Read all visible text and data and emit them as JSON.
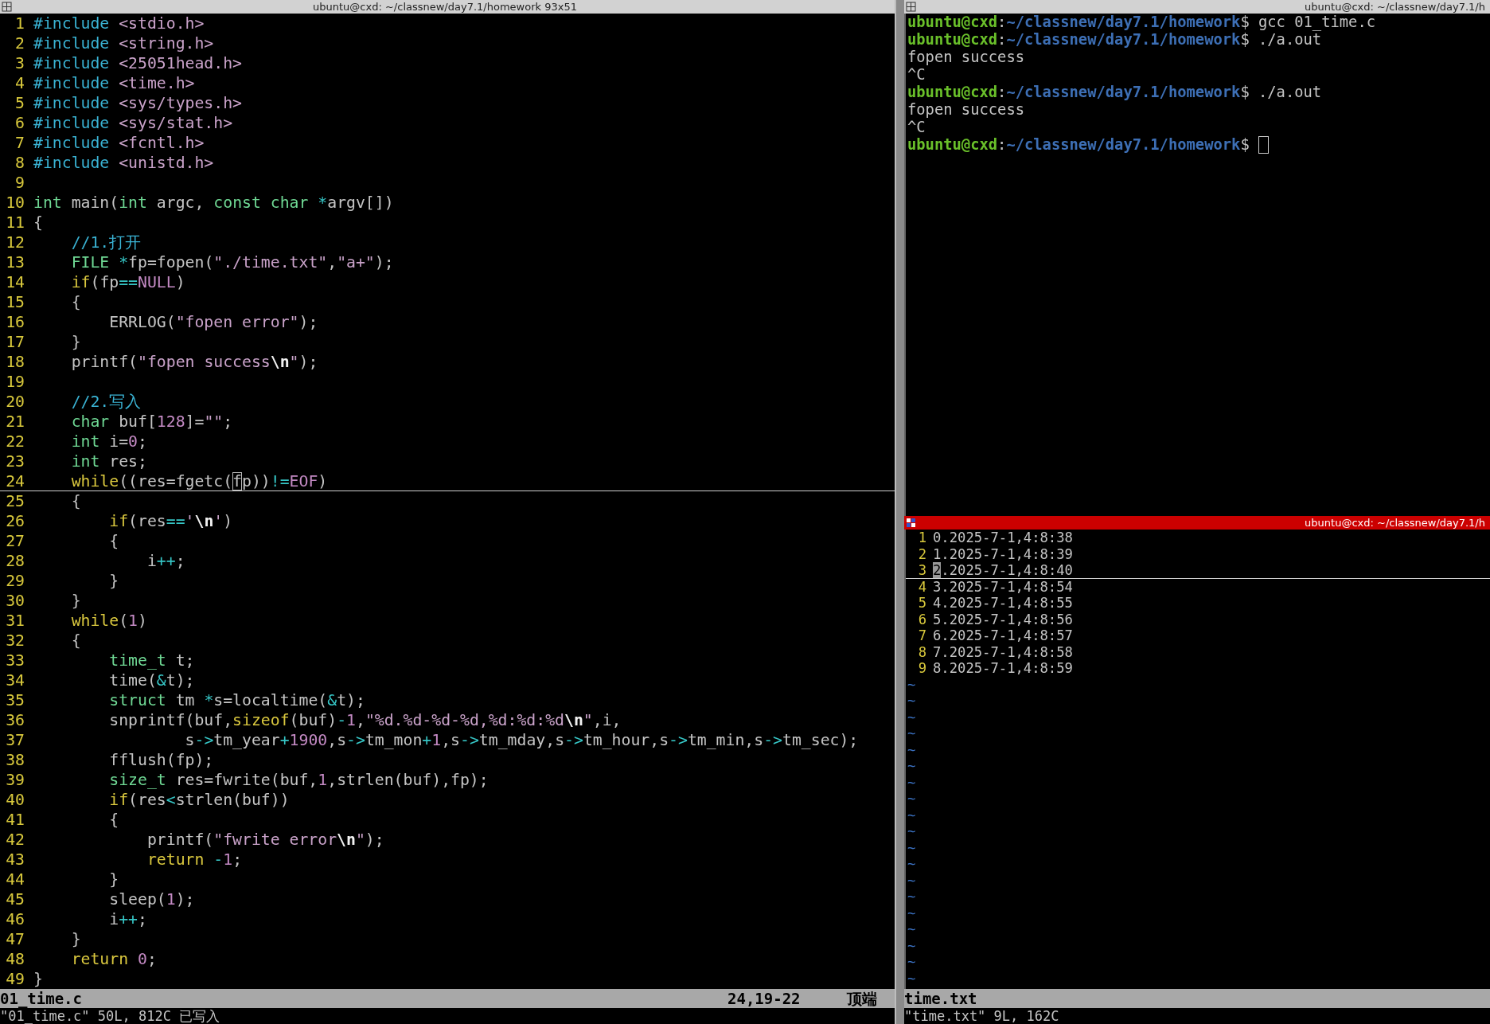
{
  "editor_pane": {
    "title": "ubuntu@cxd: ~/classnew/day7.1/homework 93x51",
    "active": false,
    "lines": [
      {
        "number": "1",
        "current": false,
        "segments": [
          {
            "kind": "pre",
            "text": "#include"
          },
          {
            "kind": "inc",
            "text": " <stdio.h>"
          }
        ]
      },
      {
        "number": "2",
        "current": false,
        "segments": [
          {
            "kind": "pre",
            "text": "#include"
          },
          {
            "kind": "inc",
            "text": " <string.h>"
          }
        ]
      },
      {
        "number": "3",
        "current": false,
        "segments": [
          {
            "kind": "pre",
            "text": "#include"
          },
          {
            "kind": "inc",
            "text": " <25051head.h>"
          }
        ]
      },
      {
        "number": "4",
        "current": false,
        "segments": [
          {
            "kind": "pre",
            "text": "#include"
          },
          {
            "kind": "inc",
            "text": " <time.h>"
          }
        ]
      },
      {
        "number": "5",
        "current": false,
        "segments": [
          {
            "kind": "pre",
            "text": "#include"
          },
          {
            "kind": "inc",
            "text": " <sys/types.h>"
          }
        ]
      },
      {
        "number": "6",
        "current": false,
        "segments": [
          {
            "kind": "pre",
            "text": "#include"
          },
          {
            "kind": "inc",
            "text": " <sys/stat.h>"
          }
        ]
      },
      {
        "number": "7",
        "current": false,
        "segments": [
          {
            "kind": "pre",
            "text": "#include"
          },
          {
            "kind": "inc",
            "text": " <fcntl.h>"
          }
        ]
      },
      {
        "number": "8",
        "current": false,
        "segments": [
          {
            "kind": "pre",
            "text": "#include"
          },
          {
            "kind": "inc",
            "text": " <unistd.h>"
          }
        ]
      },
      {
        "number": "9",
        "current": false
      },
      {
        "number": "10",
        "current": false,
        "segments": [
          {
            "kind": "type",
            "text": "int"
          },
          {
            "kind": "plain",
            "text": " main("
          },
          {
            "kind": "type",
            "text": "int"
          },
          {
            "kind": "plain",
            "text": " argc, "
          },
          {
            "kind": "type",
            "text": "const"
          },
          {
            "kind": "type",
            "text": " char"
          },
          {
            "kind": "op",
            "text": " *"
          },
          {
            "kind": "plain",
            "text": "argv[])"
          }
        ]
      },
      {
        "number": "11",
        "current": false,
        "segments": [
          {
            "kind": "plain",
            "text": "{"
          }
        ]
      },
      {
        "number": "12",
        "current": false,
        "segments": [
          {
            "kind": "comment",
            "text": "    //1.打开"
          }
        ]
      },
      {
        "number": "13",
        "current": false,
        "segments": [
          {
            "kind": "type",
            "text": "    FILE"
          },
          {
            "kind": "op",
            "text": " *"
          },
          {
            "kind": "plain",
            "text": "fp=fopen("
          },
          {
            "kind": "str",
            "text": "\"./time.txt\""
          },
          {
            "kind": "plain",
            "text": ","
          },
          {
            "kind": "str",
            "text": "\"a+\""
          },
          {
            "kind": "plain",
            "text": ");"
          }
        ]
      },
      {
        "number": "14",
        "current": false,
        "segments": [
          {
            "kind": "kw",
            "text": "    if"
          },
          {
            "kind": "plain",
            "text": "(fp"
          },
          {
            "kind": "op",
            "text": "=="
          },
          {
            "kind": "const",
            "text": "NULL"
          },
          {
            "kind": "plain",
            "text": ")"
          }
        ]
      },
      {
        "number": "15",
        "current": false,
        "segments": [
          {
            "kind": "plain",
            "text": "    {"
          }
        ]
      },
      {
        "number": "16",
        "current": false,
        "segments": [
          {
            "kind": "plain",
            "text": "        ERRLOG("
          },
          {
            "kind": "str",
            "text": "\"fopen error\""
          },
          {
            "kind": "plain",
            "text": ");"
          }
        ]
      },
      {
        "number": "17",
        "current": false,
        "segments": [
          {
            "kind": "plain",
            "text": "    }"
          }
        ]
      },
      {
        "number": "18",
        "current": false,
        "segments": [
          {
            "kind": "plain",
            "text": "    printf("
          },
          {
            "kind": "str",
            "text": "\"fopen success"
          },
          {
            "kind": "esc",
            "text": "\\n"
          },
          {
            "kind": "str",
            "text": "\""
          },
          {
            "kind": "plain",
            "text": ");"
          }
        ]
      },
      {
        "number": "19",
        "current": false
      },
      {
        "number": "20",
        "current": false,
        "segments": [
          {
            "kind": "comment",
            "text": "    //2.写入"
          }
        ]
      },
      {
        "number": "21",
        "current": false,
        "segments": [
          {
            "kind": "type",
            "text": "    char"
          },
          {
            "kind": "plain",
            "text": " buf["
          },
          {
            "kind": "num",
            "text": "128"
          },
          {
            "kind": "plain",
            "text": "]="
          },
          {
            "kind": "str",
            "text": "\"\""
          },
          {
            "kind": "plain",
            "text": ";"
          }
        ]
      },
      {
        "number": "22",
        "current": false,
        "segments": [
          {
            "kind": "type",
            "text": "    int"
          },
          {
            "kind": "plain",
            "text": " i="
          },
          {
            "kind": "num",
            "text": "0"
          },
          {
            "kind": "plain",
            "text": ";"
          }
        ]
      },
      {
        "number": "23",
        "current": false,
        "segments": [
          {
            "kind": "type",
            "text": "    int"
          },
          {
            "kind": "plain",
            "text": " res;"
          }
        ]
      },
      {
        "number": "24",
        "current": true,
        "segments": [
          {
            "kind": "kw",
            "text": "    while"
          },
          {
            "kind": "plain",
            "text": "((res=fgetc("
          },
          {
            "kind": "cursor",
            "text": "f"
          },
          {
            "kind": "plain",
            "text": "p))"
          },
          {
            "kind": "op",
            "text": "!="
          },
          {
            "kind": "const",
            "text": "EOF"
          },
          {
            "kind": "plain",
            "text": ")"
          }
        ]
      },
      {
        "number": "25",
        "current": false,
        "segments": [
          {
            "kind": "plain",
            "text": "    {"
          }
        ]
      },
      {
        "number": "26",
        "current": false,
        "segments": [
          {
            "kind": "kw",
            "text": "        if"
          },
          {
            "kind": "plain",
            "text": "(res"
          },
          {
            "kind": "op",
            "text": "=="
          },
          {
            "kind": "str",
            "text": "'"
          },
          {
            "kind": "esc",
            "text": "\\n"
          },
          {
            "kind": "str",
            "text": "'"
          },
          {
            "kind": "plain",
            "text": ")"
          }
        ]
      },
      {
        "number": "27",
        "current": false,
        "segments": [
          {
            "kind": "plain",
            "text": "        {"
          }
        ]
      },
      {
        "number": "28",
        "current": false,
        "segments": [
          {
            "kind": "plain",
            "text": "            i"
          },
          {
            "kind": "op",
            "text": "++"
          },
          {
            "kind": "plain",
            "text": ";"
          }
        ]
      },
      {
        "number": "29",
        "current": false,
        "segments": [
          {
            "kind": "plain",
            "text": "        }"
          }
        ]
      },
      {
        "number": "30",
        "current": false,
        "segments": [
          {
            "kind": "plain",
            "text": "    }"
          }
        ]
      },
      {
        "number": "31",
        "current": false,
        "segments": [
          {
            "kind": "kw",
            "text": "    while"
          },
          {
            "kind": "plain",
            "text": "("
          },
          {
            "kind": "num",
            "text": "1"
          },
          {
            "kind": "plain",
            "text": ")"
          }
        ]
      },
      {
        "number": "32",
        "current": false,
        "segments": [
          {
            "kind": "plain",
            "text": "    {"
          }
        ]
      },
      {
        "number": "33",
        "current": false,
        "segments": [
          {
            "kind": "type",
            "text": "        time_t"
          },
          {
            "kind": "plain",
            "text": " t;"
          }
        ]
      },
      {
        "number": "34",
        "current": false,
        "segments": [
          {
            "kind": "plain",
            "text": "        time("
          },
          {
            "kind": "op",
            "text": "&"
          },
          {
            "kind": "plain",
            "text": "t);"
          }
        ]
      },
      {
        "number": "35",
        "current": false,
        "segments": [
          {
            "kind": "type",
            "text": "        struct"
          },
          {
            "kind": "plain",
            "text": " tm"
          },
          {
            "kind": "op",
            "text": " *"
          },
          {
            "kind": "plain",
            "text": "s=localtime("
          },
          {
            "kind": "op",
            "text": "&"
          },
          {
            "kind": "plain",
            "text": "t);"
          }
        ]
      },
      {
        "number": "36",
        "current": false,
        "segments": [
          {
            "kind": "plain",
            "text": "        snprintf(buf,"
          },
          {
            "kind": "kw",
            "text": "sizeof"
          },
          {
            "kind": "plain",
            "text": "(buf)"
          },
          {
            "kind": "op",
            "text": "-"
          },
          {
            "kind": "num",
            "text": "1"
          },
          {
            "kind": "plain",
            "text": ","
          },
          {
            "kind": "str",
            "text": "\"%d.%d-%d-%d,%d:%d:%d"
          },
          {
            "kind": "esc",
            "text": "\\n"
          },
          {
            "kind": "str",
            "text": "\""
          },
          {
            "kind": "plain",
            "text": ",i,"
          }
        ]
      },
      {
        "number": "37",
        "current": false,
        "segments": [
          {
            "kind": "plain",
            "text": "                s"
          },
          {
            "kind": "op",
            "text": "->"
          },
          {
            "kind": "plain",
            "text": "tm_year"
          },
          {
            "kind": "op",
            "text": "+"
          },
          {
            "kind": "num",
            "text": "1900"
          },
          {
            "kind": "plain",
            "text": ",s"
          },
          {
            "kind": "op",
            "text": "->"
          },
          {
            "kind": "plain",
            "text": "tm_mon"
          },
          {
            "kind": "op",
            "text": "+"
          },
          {
            "kind": "num",
            "text": "1"
          },
          {
            "kind": "plain",
            "text": ",s"
          },
          {
            "kind": "op",
            "text": "->"
          },
          {
            "kind": "plain",
            "text": "tm_mday,s"
          },
          {
            "kind": "op",
            "text": "->"
          },
          {
            "kind": "plain",
            "text": "tm_hour,s"
          },
          {
            "kind": "op",
            "text": "->"
          },
          {
            "kind": "plain",
            "text": "tm_min,s"
          },
          {
            "kind": "op",
            "text": "->"
          },
          {
            "kind": "plain",
            "text": "tm_sec);"
          }
        ]
      },
      {
        "number": "38",
        "current": false,
        "segments": [
          {
            "kind": "plain",
            "text": "        fflush(fp);"
          }
        ]
      },
      {
        "number": "39",
        "current": false,
        "segments": [
          {
            "kind": "type",
            "text": "        size_t"
          },
          {
            "kind": "plain",
            "text": " res=fwrite(buf,"
          },
          {
            "kind": "num",
            "text": "1"
          },
          {
            "kind": "plain",
            "text": ",strlen(buf),fp);"
          }
        ]
      },
      {
        "number": "40",
        "current": false,
        "segments": [
          {
            "kind": "kw",
            "text": "        if"
          },
          {
            "kind": "plain",
            "text": "(res"
          },
          {
            "kind": "op",
            "text": "<"
          },
          {
            "kind": "plain",
            "text": "strlen(buf))"
          }
        ]
      },
      {
        "number": "41",
        "current": false,
        "segments": [
          {
            "kind": "plain",
            "text": "        {"
          }
        ]
      },
      {
        "number": "42",
        "current": false,
        "segments": [
          {
            "kind": "plain",
            "text": "            printf("
          },
          {
            "kind": "str",
            "text": "\"fwrite error"
          },
          {
            "kind": "esc",
            "text": "\\n"
          },
          {
            "kind": "str",
            "text": "\""
          },
          {
            "kind": "plain",
            "text": ");"
          }
        ]
      },
      {
        "number": "43",
        "current": false,
        "segments": [
          {
            "kind": "kw",
            "text": "            return"
          },
          {
            "kind": "op",
            "text": " -"
          },
          {
            "kind": "num",
            "text": "1"
          },
          {
            "kind": "plain",
            "text": ";"
          }
        ]
      },
      {
        "number": "44",
        "current": false,
        "segments": [
          {
            "kind": "plain",
            "text": "        }"
          }
        ]
      },
      {
        "number": "45",
        "current": false,
        "segments": [
          {
            "kind": "plain",
            "text": "        sleep("
          },
          {
            "kind": "num",
            "text": "1"
          },
          {
            "kind": "plain",
            "text": ");"
          }
        ]
      },
      {
        "number": "46",
        "current": false,
        "segments": [
          {
            "kind": "plain",
            "text": "        i"
          },
          {
            "kind": "op",
            "text": "++"
          },
          {
            "kind": "plain",
            "text": ";"
          }
        ]
      },
      {
        "number": "47",
        "current": false,
        "segments": [
          {
            "kind": "plain",
            "text": "    }"
          }
        ]
      },
      {
        "number": "48",
        "current": false,
        "segments": [
          {
            "kind": "kw",
            "text": "    return"
          },
          {
            "kind": "num",
            "text": " 0"
          },
          {
            "kind": "plain",
            "text": ";"
          }
        ]
      },
      {
        "number": "49",
        "current": false,
        "segments": [
          {
            "kind": "plain",
            "text": "}"
          }
        ]
      }
    ],
    "status": {
      "file": "01_time.c",
      "position": "24,19-22",
      "scroll": "顶端"
    },
    "message": "\"01_time.c\" 50L, 812C 已写入"
  },
  "terminal_pane": {
    "title": "ubuntu@cxd: ~/classnew/day7.1/h",
    "active": false,
    "lines": [
      {
        "cursor": false,
        "segments": [
          {
            "kind": "user",
            "text": "ubuntu@cxd"
          },
          {
            "kind": "plain",
            "text": ":"
          },
          {
            "kind": "path",
            "text": "~/classnew/day7.1/homework"
          },
          {
            "kind": "plain",
            "text": "$ gcc 01_time.c"
          }
        ]
      },
      {
        "cursor": false,
        "segments": [
          {
            "kind": "user",
            "text": "ubuntu@cxd"
          },
          {
            "kind": "plain",
            "text": ":"
          },
          {
            "kind": "path",
            "text": "~/classnew/day7.1/homework"
          },
          {
            "kind": "plain",
            "text": "$ ./a.out"
          }
        ]
      },
      {
        "cursor": false,
        "segments": [
          {
            "kind": "plain",
            "text": "fopen success"
          }
        ]
      },
      {
        "cursor": false,
        "segments": [
          {
            "kind": "plain",
            "text": "^C"
          }
        ]
      },
      {
        "cursor": false,
        "segments": [
          {
            "kind": "user",
            "text": "ubuntu@cxd"
          },
          {
            "kind": "plain",
            "text": ":"
          },
          {
            "kind": "path",
            "text": "~/classnew/day7.1/homework"
          },
          {
            "kind": "plain",
            "text": "$ ./a.out"
          }
        ]
      },
      {
        "cursor": false,
        "segments": [
          {
            "kind": "plain",
            "text": "fopen success"
          }
        ]
      },
      {
        "cursor": false,
        "segments": [
          {
            "kind": "plain",
            "text": "^C"
          }
        ]
      },
      {
        "cursor": true,
        "segments": [
          {
            "kind": "user",
            "text": "ubuntu@cxd"
          },
          {
            "kind": "plain",
            "text": ":"
          },
          {
            "kind": "path",
            "text": "~/classnew/day7.1/homework"
          },
          {
            "kind": "plain",
            "text": "$ "
          }
        ]
      }
    ]
  },
  "viewer_pane": {
    "title": "ubuntu@cxd: ~/classnew/day7.1/h",
    "active": true,
    "lines": [
      {
        "number": "1",
        "current": false,
        "text": "0.2025-7-1,4:8:38"
      },
      {
        "number": "2",
        "current": false,
        "text": "1.2025-7-1,4:8:39"
      },
      {
        "number": "3",
        "current": true,
        "text": "2.2025-7-1,4:8:40"
      },
      {
        "number": "4",
        "current": false,
        "text": "3.2025-7-1,4:8:54"
      },
      {
        "number": "5",
        "current": false,
        "text": "4.2025-7-1,4:8:55"
      },
      {
        "number": "6",
        "current": false,
        "text": "5.2025-7-1,4:8:56"
      },
      {
        "number": "7",
        "current": false,
        "text": "6.2025-7-1,4:8:57"
      },
      {
        "number": "8",
        "current": false,
        "text": "7.2025-7-1,4:8:58"
      },
      {
        "number": "9",
        "current": false,
        "text": "8.2025-7-1,4:8:59"
      }
    ],
    "tildes": [
      "~",
      "~",
      "~",
      "~",
      "~",
      "~",
      "~",
      "~",
      "~",
      "~",
      "~",
      "~",
      "~",
      "~",
      "~",
      "~",
      "~",
      "~",
      "~"
    ],
    "status": {
      "file": "time.txt"
    },
    "message": "\"time.txt\" 9L, 162C"
  }
}
